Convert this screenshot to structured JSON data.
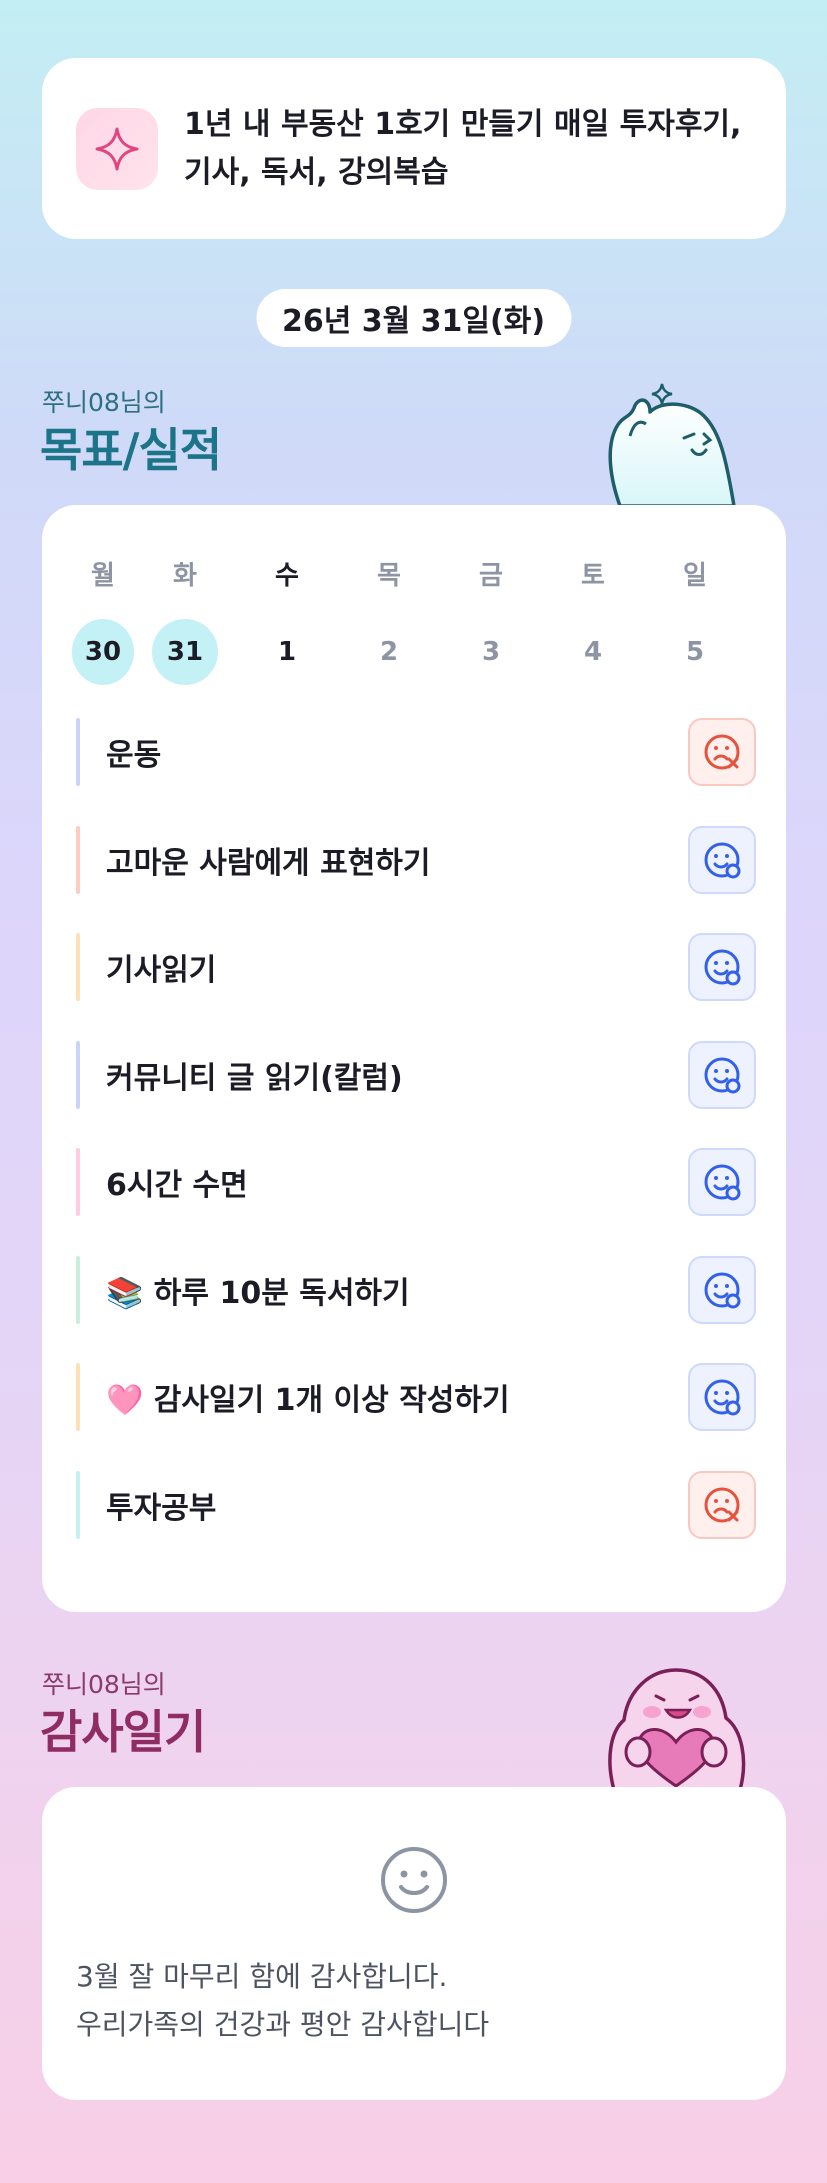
{
  "goal": {
    "icon": "sparkle-icon",
    "line1": "1년 내 부동산 1호기 만들기 매일 투자후기,",
    "line2": "기사, 독서, 강의복습"
  },
  "date": "26년 3월 31일(화)",
  "goals_section": {
    "owner": "쭈니08님의",
    "title": "목표/실적"
  },
  "week": {
    "days_of_week": [
      "월",
      "화",
      "수",
      "목",
      "금",
      "토",
      "일"
    ],
    "dates": [
      "30",
      "31",
      "1",
      "2",
      "3",
      "4",
      "5"
    ],
    "completed": [
      "30",
      "31"
    ],
    "today_index": 2
  },
  "tasks": [
    {
      "label": "운동",
      "status": "fail",
      "bar_color": "#c9d4fb"
    },
    {
      "label": "고마운 사람에게 표현하기",
      "status": "ok",
      "bar_color": "#ffcdbf"
    },
    {
      "label": "기사읽기",
      "status": "ok",
      "bar_color": "#ffe1b8"
    },
    {
      "label": "커뮤니티 글 읽기(칼럼)",
      "status": "ok",
      "bar_color": "#c9d4fb"
    },
    {
      "label": "6시간 수면",
      "status": "ok",
      "bar_color": "#ffcce2"
    },
    {
      "label": "📚 하루 10분 독서하기",
      "status": "ok",
      "bar_color": "#c6f0dc"
    },
    {
      "label": "🩷 감사일기 1개 이상 작성하기",
      "status": "ok",
      "bar_color": "#ffe1b8"
    },
    {
      "label": "투자공부",
      "status": "fail",
      "bar_color": "#c4f1f5"
    }
  ],
  "diary_section": {
    "owner": "쭈니08님의",
    "title": "감사일기"
  },
  "diary": {
    "icon": "smile-icon",
    "line1": "3월 잘 마무리 함에 감사합니다.",
    "line2": "우리가족의 건강과 평안 감사합니다"
  },
  "colors": {
    "done_circle": "#c4f1f5",
    "ok_icon": "#3360e8",
    "fail_icon": "#e5533d",
    "goals_title": "#1b7488",
    "diary_title": "#8e2c63"
  }
}
